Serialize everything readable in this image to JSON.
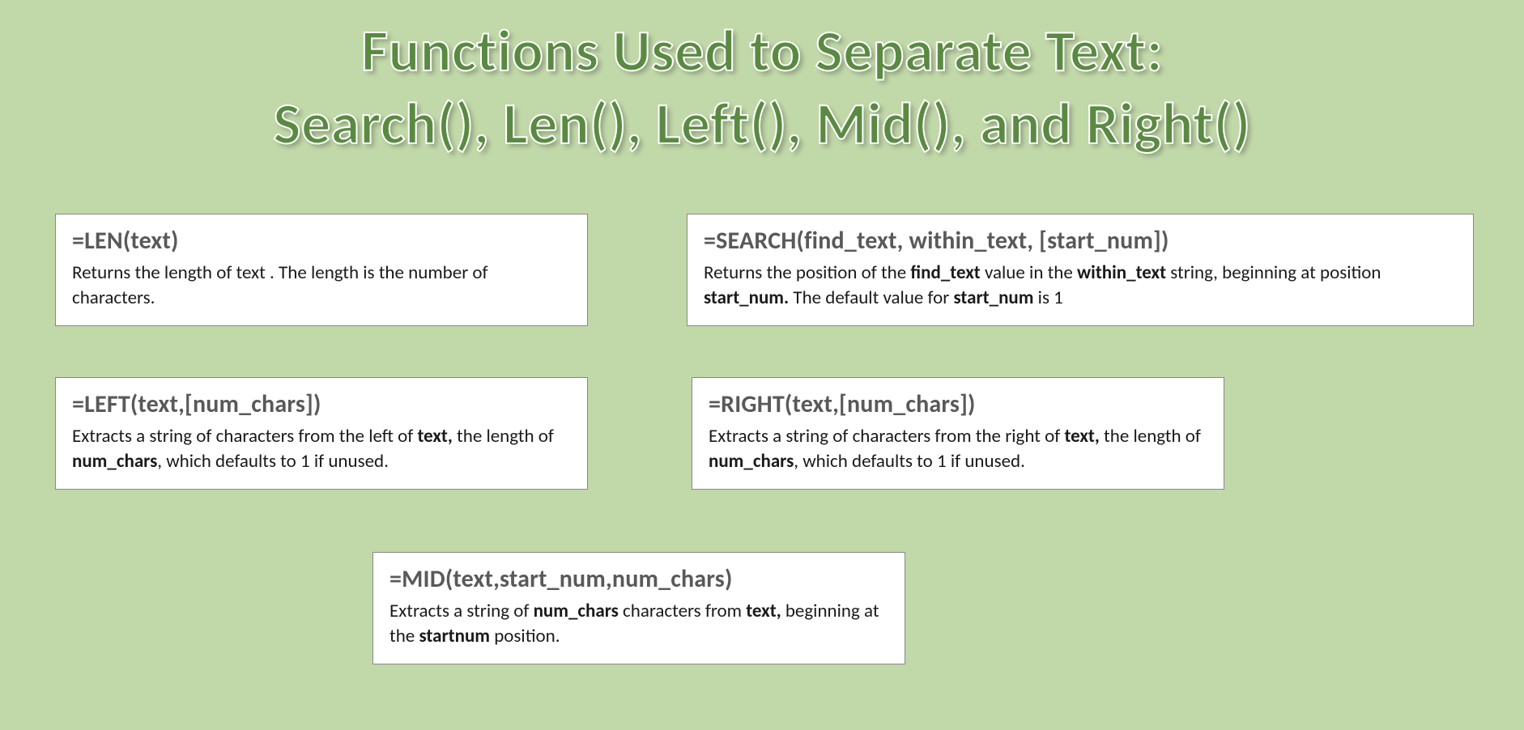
{
  "title_line1": "Functions Used to Separate Text:",
  "title_line2": "Search(), Len(), Left(), Mid(), and Right()",
  "cards": {
    "len": {
      "heading": "=LEN(text)",
      "desc": "Returns the length of text . The length is the number of characters."
    },
    "search": {
      "heading": "=SEARCH(find_text, within_text, [start_num])",
      "desc_pre": "Returns the position of the ",
      "t1": "find_text",
      "desc_mid1": " value in the ",
      "t2": "within_text",
      "desc_mid2": " string, beginning at position ",
      "t3": "start_num.",
      "desc_mid3": " The default value for ",
      "t4": "start_num",
      "desc_end": " is 1"
    },
    "left": {
      "heading": "=LEFT(text,[num_chars])",
      "desc_pre": "Extracts a string of characters from the left of ",
      "t1": "text,",
      "desc_mid": " the length of ",
      "t2": "num_chars",
      "desc_end": ", which defaults to 1 if unused."
    },
    "right": {
      "heading": "=RIGHT(text,[num_chars])",
      "desc_pre": "Extracts a string of characters from the right of ",
      "t1": "text,",
      "desc_mid": " the length of ",
      "t2": "num_chars",
      "desc_end": ", which defaults to 1 if unused."
    },
    "mid": {
      "heading": "=MID(text,start_num,num_chars)",
      "desc_pre": "Extracts a string of ",
      "t1": "num_chars",
      "desc_mid1": " characters from ",
      "t2": "text,",
      "desc_mid2": " beginning at the ",
      "t3": "startnum",
      "desc_end": " position."
    }
  }
}
